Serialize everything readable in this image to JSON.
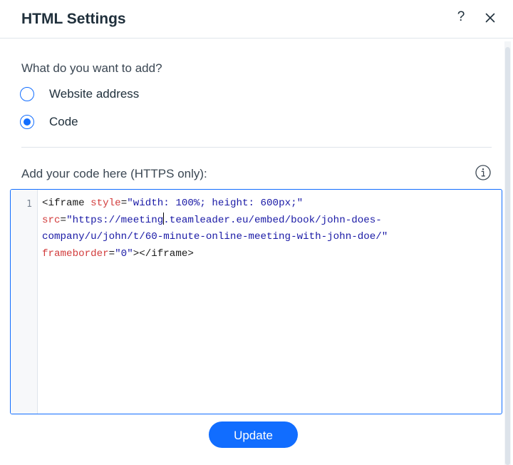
{
  "dialog": {
    "title": "HTML Settings",
    "help_label": "?"
  },
  "add_type": {
    "question": "What do you want to add?",
    "options": [
      {
        "label": "Website address",
        "selected": false
      },
      {
        "label": "Code",
        "selected": true
      }
    ]
  },
  "code_section": {
    "label": "Add your code here (HTTPS only):",
    "line_number": "1",
    "lines": [
      [
        {
          "t": "tag",
          "v": "<iframe "
        },
        {
          "t": "attr",
          "v": "style"
        },
        {
          "t": "plain",
          "v": "="
        },
        {
          "t": "str",
          "v": "\"width: 100%; height: 600px;\""
        }
      ],
      [
        {
          "t": "attr",
          "v": "src"
        },
        {
          "t": "plain",
          "v": "="
        },
        {
          "t": "str",
          "v": "\"https://meeting"
        },
        {
          "t": "caret",
          "v": ""
        },
        {
          "t": "str",
          "v": ".teamleader.eu/embed/book/john-does-"
        }
      ],
      [
        {
          "t": "str",
          "v": "company/u/john/t/60-minute-online-meeting-with-john-doe/\""
        }
      ],
      [
        {
          "t": "attr",
          "v": "frameborder"
        },
        {
          "t": "plain",
          "v": "="
        },
        {
          "t": "str",
          "v": "\"0\""
        },
        {
          "t": "tag",
          "v": "></iframe>"
        }
      ]
    ]
  },
  "actions": {
    "update_label": "Update"
  },
  "colors": {
    "accent": "#116dff",
    "title_text": "#20303c",
    "attr_token": "#d23c3c",
    "string_token": "#1a1aa6"
  },
  "icons": {
    "help": "question-mark-icon",
    "close": "close-icon",
    "info": "info-icon"
  }
}
